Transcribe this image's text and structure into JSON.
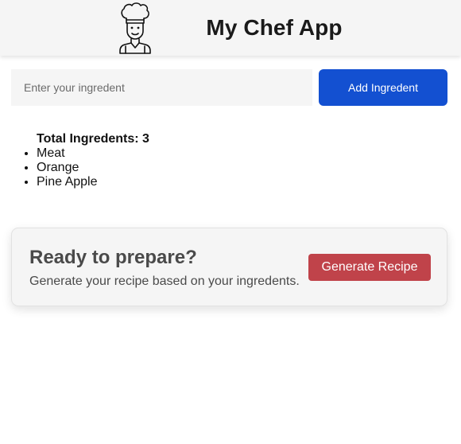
{
  "header": {
    "icon": "chef-icon",
    "title": "My Chef App"
  },
  "form": {
    "placeholder": "Enter your ingredent",
    "value": "",
    "add_label": "Add Ingredent",
    "accent_color": "#1350d1"
  },
  "ingredients": {
    "count_label": "Total Ingredents: 3",
    "items": [
      "Meat",
      "Orange",
      "Pine Apple"
    ]
  },
  "recipe_card": {
    "title": "Ready to prepare?",
    "description": "Generate your recipe based on your ingredents.",
    "button_label": "Generate Recipe",
    "button_color": "#c0434a"
  }
}
